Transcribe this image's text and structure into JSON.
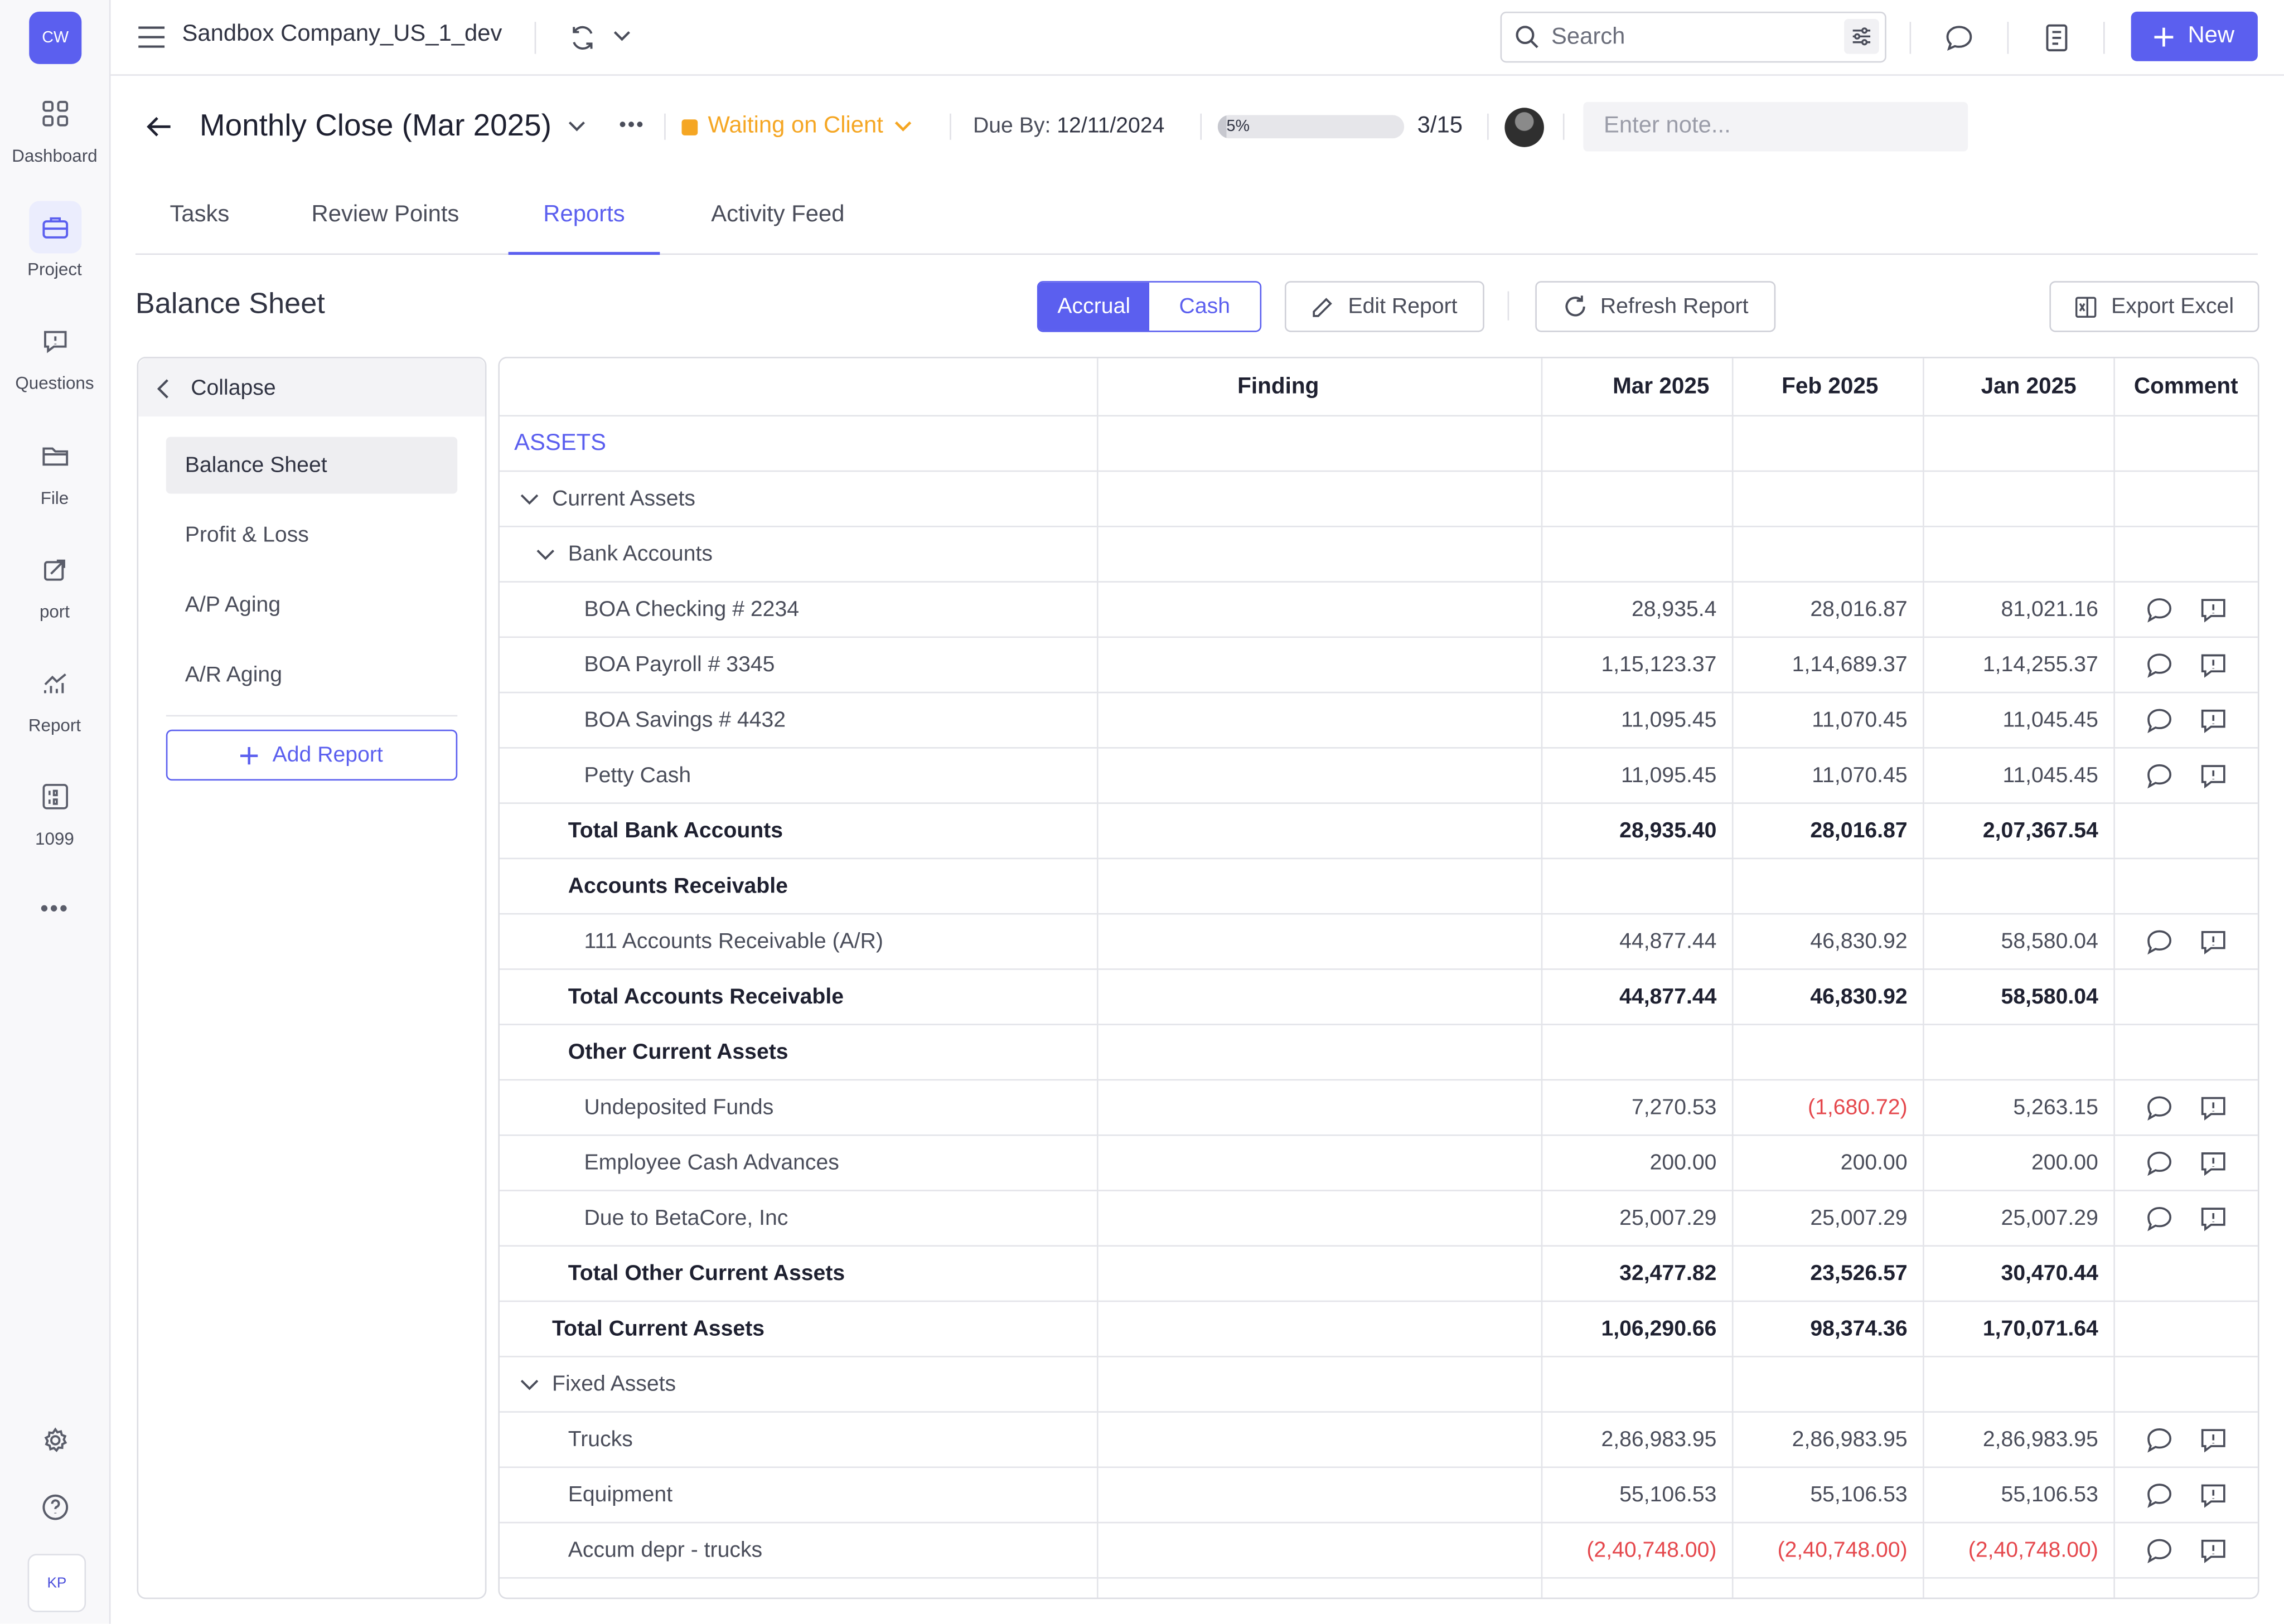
{
  "app": {
    "logo": "CW",
    "company": "Sandbox Company_US_1_dev",
    "user_initials": "KP"
  },
  "nav": [
    {
      "label": "Dashboard",
      "icon": "grid-icon"
    },
    {
      "label": "Project",
      "icon": "briefcase-icon"
    },
    {
      "label": "Questions",
      "icon": "question-bubble-icon"
    },
    {
      "label": "File",
      "icon": "folder-icon"
    },
    {
      "label": "port",
      "icon": "import-icon"
    },
    {
      "label": "Report",
      "icon": "chart-icon"
    },
    {
      "label": "1099",
      "icon": "form-1099-icon"
    }
  ],
  "topbar": {
    "search_placeholder": "Search",
    "new_label": "New"
  },
  "header": {
    "title": "Monthly Close (Mar 2025)",
    "status": "Waiting on Client",
    "status_color": "#f5a623",
    "due_label": "Due By:",
    "due_date": "12/11/2024",
    "progress": 5,
    "progress_label": "5%",
    "count": "3/15",
    "note_placeholder": "Enter note..."
  },
  "tabs": [
    "Tasks",
    "Review Points",
    "Reports",
    "Activity Feed"
  ],
  "toolbar": {
    "section_title": "Balance Sheet",
    "accrual": "Accrual",
    "cash": "Cash",
    "edit": "Edit Report",
    "refresh": "Refresh Report",
    "export": "Export Excel"
  },
  "side": {
    "collapse": "Collapse",
    "reports": [
      "Balance Sheet",
      "Profit & Loss",
      "A/P Aging",
      "A/R Aging"
    ],
    "add": "Add Report"
  },
  "table": {
    "headers": [
      "",
      "Finding",
      "Mar 2025",
      "Feb 2025",
      "Jan 2025",
      "Comment"
    ],
    "section": "ASSETS",
    "rows": [
      {
        "label": "Current Assets",
        "level": 0,
        "chevron": true
      },
      {
        "label": "Bank Accounts",
        "level": 1,
        "chevron": true
      },
      {
        "label": "BOA Checking # 2234",
        "level": 2,
        "values": [
          "28,935.4",
          "28,016.87",
          "81,021.16"
        ],
        "comments": true
      },
      {
        "label": "BOA Payroll # 3345",
        "level": 2,
        "values": [
          "1,15,123.37",
          "1,14,689.37",
          "1,14,255.37"
        ],
        "comments": true
      },
      {
        "label": "BOA Savings # 4432",
        "level": 2,
        "values": [
          "11,095.45",
          "11,070.45",
          "11,045.45"
        ],
        "comments": true
      },
      {
        "label": "Petty Cash",
        "level": 2,
        "values": [
          "11,095.45",
          "11,070.45",
          "11,045.45"
        ],
        "comments": true
      },
      {
        "label": "Total Bank Accounts",
        "level": 1,
        "bold": true,
        "values": [
          "28,935.40",
          "28,016.87",
          "2,07,367.54"
        ]
      },
      {
        "label": "Accounts Receivable",
        "level": 1,
        "bold": true
      },
      {
        "label": "111 Accounts Receivable (A/R)",
        "level": 2,
        "values": [
          "44,877.44",
          "46,830.92",
          "58,580.04"
        ],
        "comments": true
      },
      {
        "label": "Total Accounts Receivable",
        "level": 1,
        "bold": true,
        "values": [
          "44,877.44",
          "46,830.92",
          "58,580.04"
        ]
      },
      {
        "label": "Other Current Assets",
        "level": 1,
        "bold": true
      },
      {
        "label": "Undeposited Funds",
        "level": 2,
        "values": [
          "7,270.53",
          "(1,680.72)",
          "5,263.15"
        ],
        "comments": true
      },
      {
        "label": "Employee Cash Advances",
        "level": 2,
        "values": [
          "200.00",
          "200.00",
          "200.00"
        ],
        "comments": true
      },
      {
        "label": "Due to BetaCore, Inc",
        "level": 2,
        "values": [
          "25,007.29",
          "25,007.29",
          "25,007.29"
        ],
        "comments": true
      },
      {
        "label": "Total Other Current Assets",
        "level": 1,
        "bold": true,
        "values": [
          "32,477.82",
          "23,526.57",
          "30,470.44"
        ]
      },
      {
        "label": "Total Current Assets",
        "level": 0,
        "bold": true,
        "values": [
          "1,06,290.66",
          "98,374.36",
          "1,70,071.64"
        ]
      },
      {
        "label": "Fixed Assets",
        "level": 0,
        "chevron": true
      },
      {
        "label": "Trucks",
        "level": 1,
        "values": [
          "2,86,983.95",
          "2,86,983.95",
          "2,86,983.95"
        ],
        "comments": true
      },
      {
        "label": "Equipment",
        "level": 1,
        "values": [
          "55,106.53",
          "55,106.53",
          "55,106.53"
        ],
        "comments": true
      },
      {
        "label": "Accum depr - trucks",
        "level": 1,
        "values": [
          "(2,40,748.00)",
          "(2,40,748.00)",
          "(2,40,748.00)"
        ],
        "comments": true
      },
      {
        "label": "",
        "level": 1
      }
    ]
  },
  "colors": {
    "accent": "#5b5fef",
    "negative": "#e5484d",
    "warning": "#f5a623"
  }
}
